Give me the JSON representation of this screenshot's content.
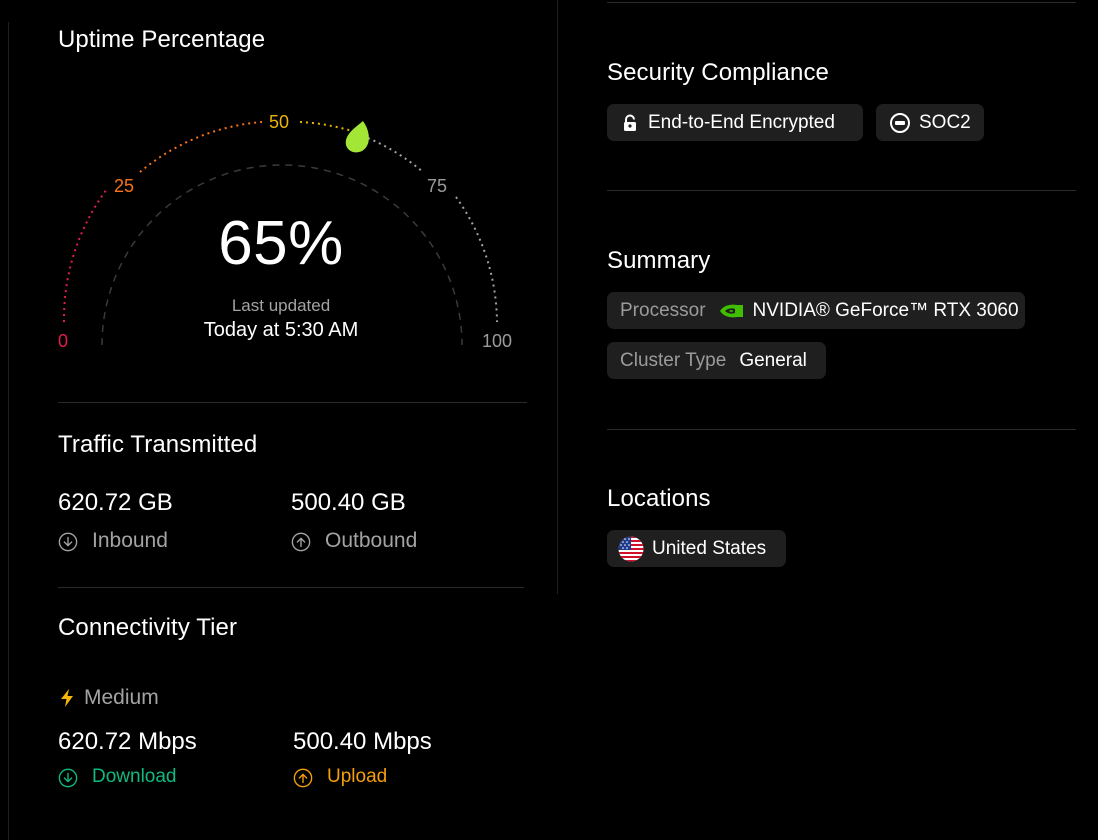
{
  "uptime": {
    "title": "Uptime Percentage",
    "value_label": "65%",
    "value": 65,
    "last_updated_label": "Last updated",
    "last_updated": "Today at 5:30 AM",
    "ticks": [
      "0",
      "25",
      "50",
      "75",
      "100"
    ],
    "colors": {
      "low": "#e11d48",
      "mid_low": "#f97316",
      "mid": "#eab308",
      "high": "#a3a3a3",
      "marker": "#a3e635"
    }
  },
  "traffic": {
    "title": "Traffic Transmitted",
    "inbound_value": "620.72 GB",
    "inbound_label": "Inbound",
    "outbound_value": "500.40 GB",
    "outbound_label": "Outbound"
  },
  "connectivity": {
    "title": "Connectivity Tier",
    "tier": "Medium",
    "tier_icon": "lightning-icon",
    "download_value": "620.72 Mbps",
    "download_label": "Download",
    "upload_value": "500.40 Mbps",
    "upload_label": "Upload",
    "colors": {
      "download": "#10b981",
      "upload": "#f59e0b"
    }
  },
  "security": {
    "title": "Security Compliance",
    "badges": [
      {
        "label": "End-to-End Encrypted",
        "icon": "lock-icon"
      },
      {
        "label": "SOC2",
        "icon": "soc2-icon"
      }
    ]
  },
  "summary": {
    "title": "Summary",
    "processor_key": "Processor",
    "processor_value": "NVIDIA® GeForce™ RTX 3060",
    "processor_icon": "nvidia-icon",
    "cluster_key": "Cluster Type",
    "cluster_value": "General"
  },
  "locations": {
    "title": "Locations",
    "items": [
      {
        "label": "United States",
        "icon": "us-flag-icon"
      }
    ]
  }
}
